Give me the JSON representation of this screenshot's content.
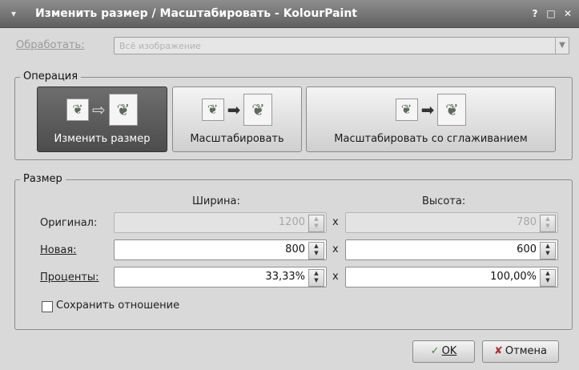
{
  "window": {
    "title": "Изменить размер / Масштабировать - KolourPaint",
    "help_glyph": "?",
    "maximize_glyph": "□",
    "close_glyph": "✕"
  },
  "process": {
    "label": "Обработать:",
    "value": "Всё изображение"
  },
  "operation": {
    "group_title": "Операция",
    "buttons": [
      {
        "label": "Изменить размер",
        "selected": true
      },
      {
        "label": "Масштабировать",
        "selected": false
      },
      {
        "label": "Масштабировать со сглаживанием",
        "selected": false
      }
    ]
  },
  "size": {
    "group_title": "Размер",
    "width_header": "Ширина:",
    "height_header": "Высота:",
    "times": "x",
    "rows": [
      {
        "label": "Оригинал:",
        "width": "1200",
        "height": "780",
        "enabled": false
      },
      {
        "label": "Новая:",
        "width": "800",
        "height": "600",
        "enabled": true
      },
      {
        "label": "Проценты:",
        "width": "33,33%",
        "height": "100,00%",
        "enabled": true
      }
    ],
    "keep_ratio_label": "Сохранить отношение",
    "keep_ratio_checked": false
  },
  "buttons": {
    "ok_label": "OK",
    "cancel_label": "Отмена"
  }
}
